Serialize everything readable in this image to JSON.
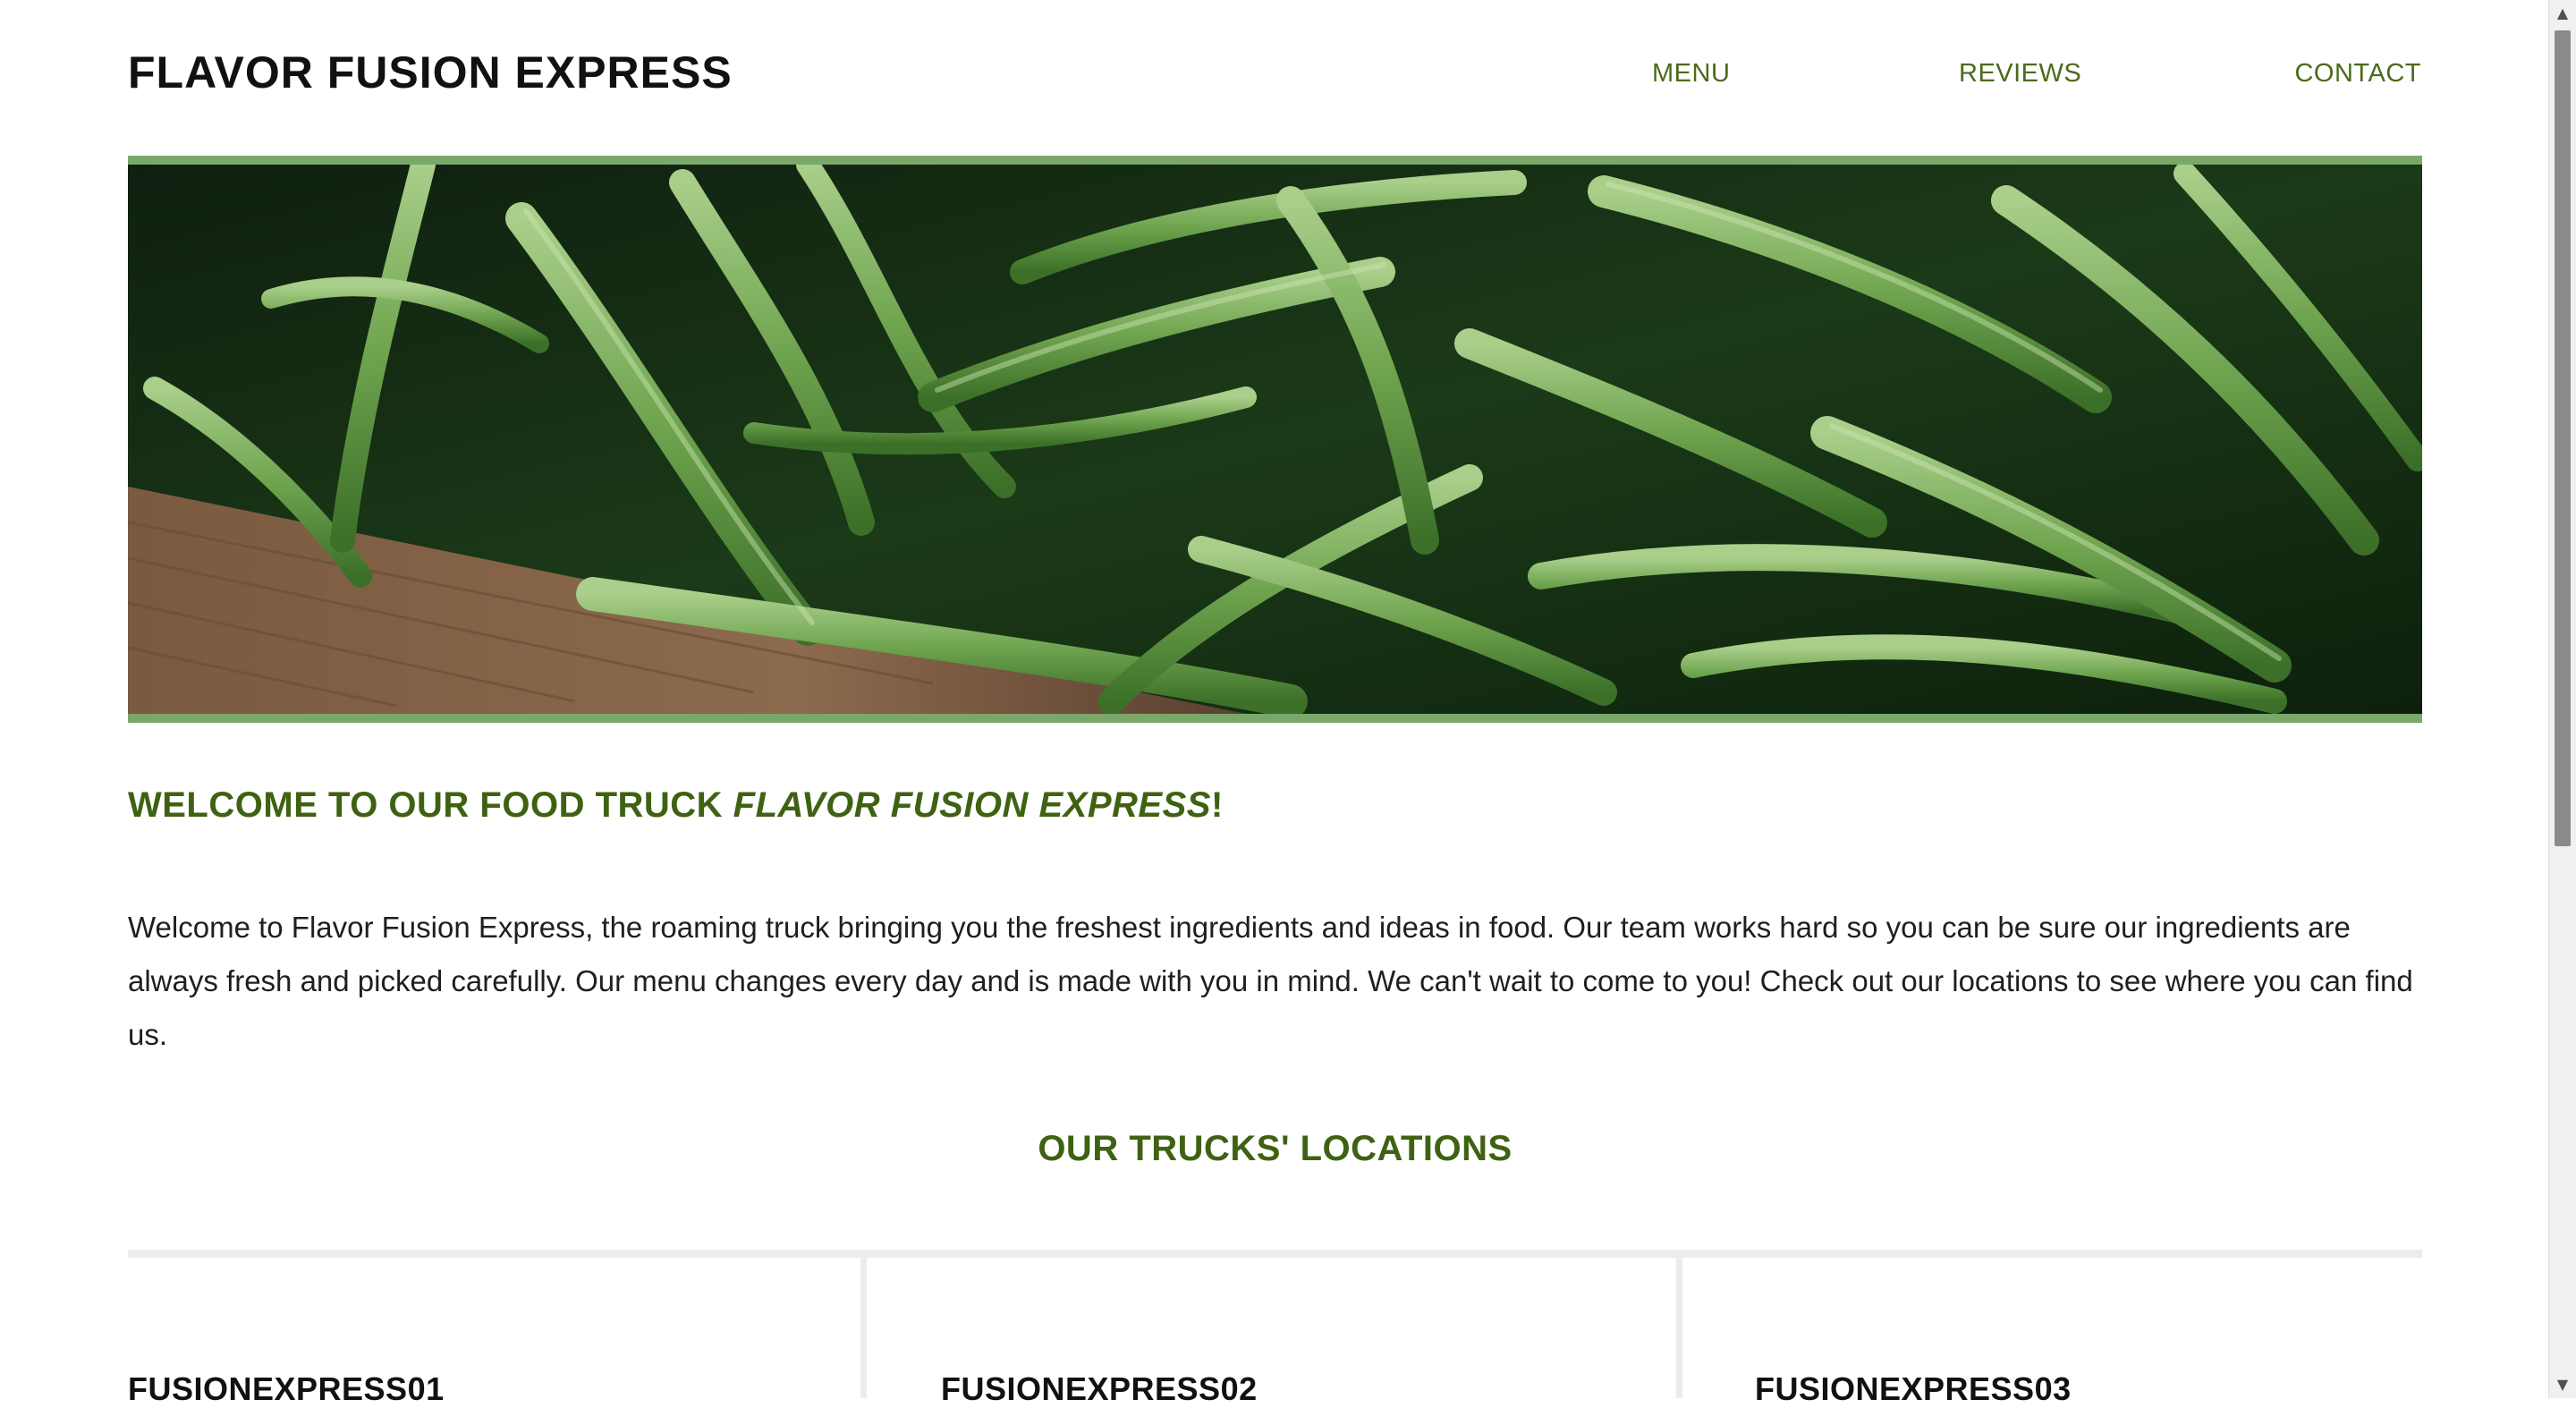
{
  "header": {
    "site_title": "FLAVOR FUSION EXPRESS",
    "nav": [
      {
        "label": "MENU"
      },
      {
        "label": "REVIEWS"
      },
      {
        "label": "CONTACT"
      }
    ]
  },
  "hero": {
    "image": "green-beans-photo",
    "frame_color": "#7aa86b"
  },
  "welcome": {
    "prefix": "WELCOME TO OUR FOOD TRUCK ",
    "name": "FLAVOR FUSION EXPRESS",
    "suffix": "!"
  },
  "intro": {
    "text": "Welcome to Flavor Fusion Express, the roaming truck bringing you the freshest ingredients and ideas in food. Our team works hard so you can be sure our ingredients are always fresh and picked carefully. Our menu changes every day and is made with you in mind. We can't wait to come to you! Check out our locations to see where you can find us."
  },
  "locations": {
    "title": "OUR TRUCKS' LOCATIONS",
    "trucks": [
      {
        "name": "FUSIONEXPRESS01"
      },
      {
        "name": "FUSIONEXPRESS02"
      },
      {
        "name": "FUSIONEXPRESS03"
      }
    ]
  },
  "colors": {
    "accent_green": "#3f6212",
    "nav_green": "#4a6b1a",
    "hero_frame": "#7aa86b"
  },
  "scrollbar": {
    "up_icon": "arrow-up-icon",
    "down_icon": "arrow-down-icon"
  }
}
